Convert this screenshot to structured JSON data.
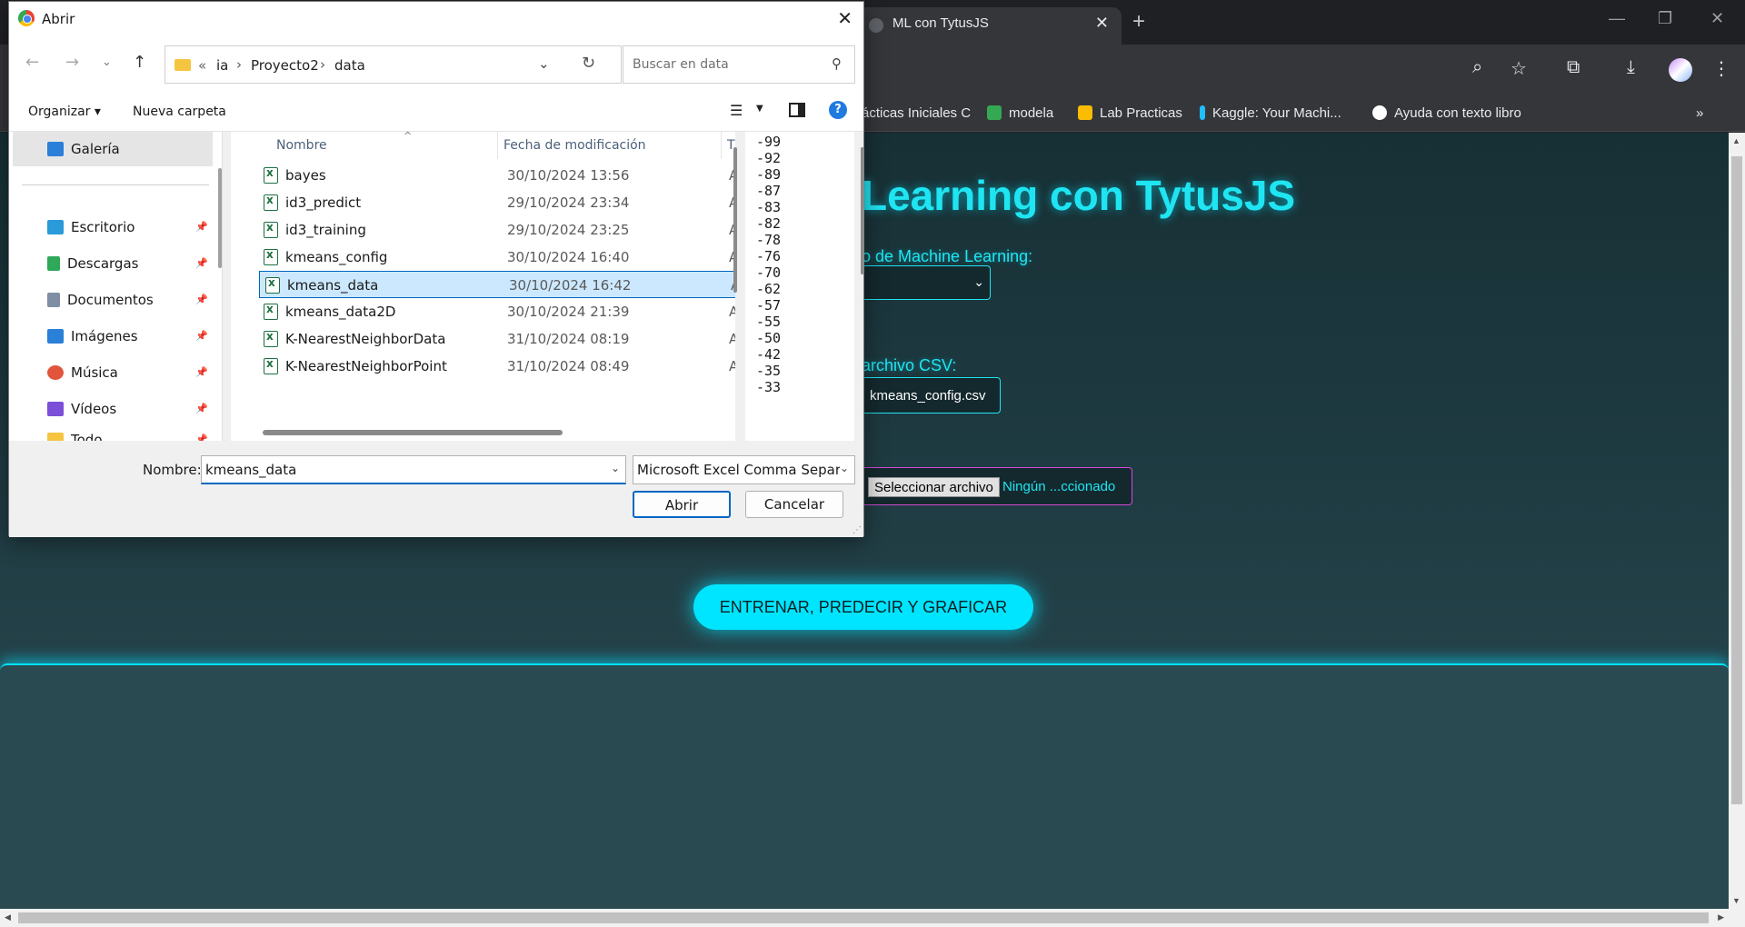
{
  "browser": {
    "tab_title": "ML con TytusJS",
    "new_tab": "+",
    "bookmarks": [
      {
        "label": "ácticas Iniciales C",
        "color": "#4a4b4f"
      },
      {
        "label": "modela",
        "color": "#34a853"
      },
      {
        "label": "Lab Practicas",
        "color": "#fbbc04"
      },
      {
        "label": "Kaggle: Your Machi...",
        "color": "#20beff"
      },
      {
        "label": "Ayuda con texto libro",
        "color": "#ffffff"
      }
    ]
  },
  "page": {
    "title": "Learning con TytusJS",
    "algo_label": "o de Machine Learning:",
    "csv_label": "archivo CSV:",
    "csv_file": "kmeans_config.csv",
    "file_button": "Seleccionar archivo",
    "file_none": "Ningún ...ccionado",
    "train_button": "ENTRENAR, PREDECIR Y GRAFICAR"
  },
  "dialog": {
    "title": "Abrir",
    "breadcrumb": [
      "«",
      "ia",
      "Proyecto2",
      "data"
    ],
    "search_placeholder": "Buscar en data",
    "organize": "Organizar ▾",
    "new_folder": "Nueva carpeta",
    "help": "?",
    "sidebar": {
      "gallery": "Galería",
      "items": [
        {
          "label": "Escritorio",
          "color": "#2a9ad8"
        },
        {
          "label": "Descargas",
          "color": "#2fa85a"
        },
        {
          "label": "Documentos",
          "color": "#7f8ea3"
        },
        {
          "label": "Imágenes",
          "color": "#2a7fd8"
        },
        {
          "label": "Música",
          "color": "#e2553d"
        },
        {
          "label": "Vídeos",
          "color": "#7b4fd8"
        },
        {
          "label": "Todo",
          "color": "#f5c542"
        }
      ]
    },
    "columns": {
      "name": "Nombre",
      "modified": "Fecha de modificación",
      "type": "T"
    },
    "files": [
      {
        "name": "bayes",
        "date": "30/10/2024 13:56",
        "type": "A"
      },
      {
        "name": "id3_predict",
        "date": "29/10/2024 23:34",
        "type": "A"
      },
      {
        "name": "id3_training",
        "date": "29/10/2024 23:25",
        "type": "A"
      },
      {
        "name": "kmeans_config",
        "date": "30/10/2024 16:40",
        "type": "A"
      },
      {
        "name": "kmeans_data",
        "date": "30/10/2024 16:42",
        "type": "A"
      },
      {
        "name": "kmeans_data2D",
        "date": "30/10/2024 21:39",
        "type": "A"
      },
      {
        "name": "K-NearestNeighborData",
        "date": "31/10/2024 08:19",
        "type": "A"
      },
      {
        "name": "K-NearestNeighborPoint",
        "date": "31/10/2024 08:49",
        "type": "A"
      }
    ],
    "selected_index": 4,
    "preview_lines": [
      "-99",
      "-92",
      "-89",
      "-87",
      "-83",
      "-82",
      "-78",
      "-76",
      "-70",
      "-62",
      "-57",
      "-55",
      "-50",
      "-42",
      "-35",
      "-33"
    ],
    "name_label": "Nombre:",
    "name_value": "kmeans_data",
    "file_type": "Microsoft Excel Comma Separa",
    "open_button": "Abrir",
    "cancel_button": "Cancelar"
  }
}
